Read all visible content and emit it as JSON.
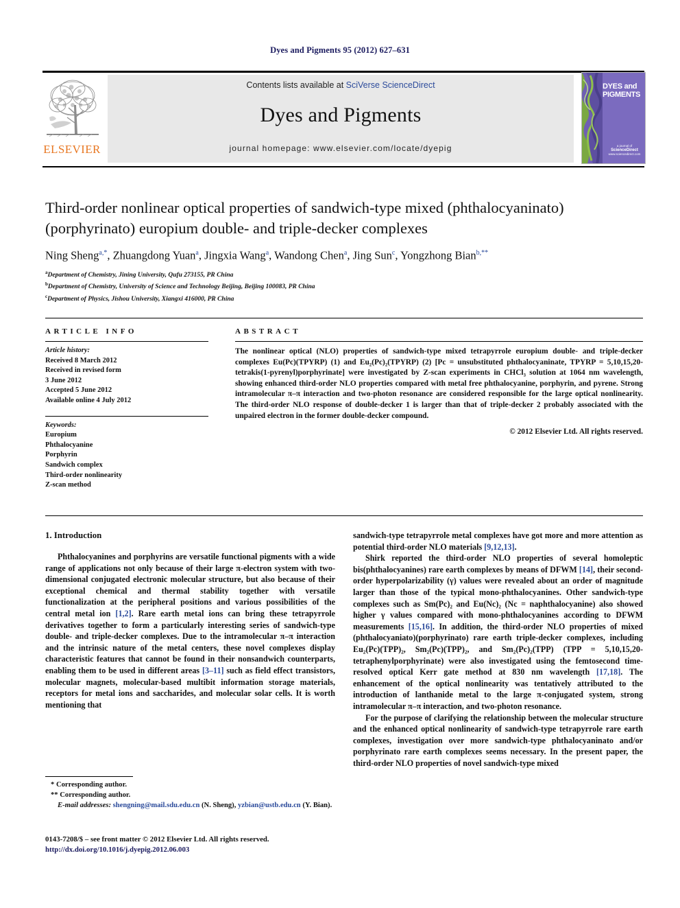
{
  "running_head": "Dyes and Pigments 95 (2012) 627–631",
  "masthead": {
    "contents_prefix": "Contents lists available at ",
    "sciencedirect": "SciVerse ScienceDirect",
    "journal_name": "Dyes and Pigments",
    "homepage": "journal homepage: www.elsevier.com/locate/dyepig",
    "publisher_logo_text": "ELSEVIER",
    "cover_title": "DYES and PIGMENTS",
    "cover_footer_small": "a journal of",
    "cover_footer_brand": "ScienceDirect",
    "cover_footer_url": "www.sciencedirect.com",
    "accent_orange": "#E87722",
    "link_blue": "#2c4b9b",
    "cover_purple": "#7b6bbf"
  },
  "article": {
    "title": "Third-order nonlinear optical properties of sandwich-type mixed (phthalocyaninato)(porphyrinato) europium double- and triple-decker complexes",
    "authors": [
      {
        "name": "Ning Sheng",
        "sup": "a,*"
      },
      {
        "name": "Zhuangdong Yuan",
        "sup": "a"
      },
      {
        "name": "Jingxia Wang",
        "sup": "a"
      },
      {
        "name": "Wandong Chen",
        "sup": "a"
      },
      {
        "name": "Jing Sun",
        "sup": "c"
      },
      {
        "name": "Yongzhong Bian",
        "sup": "b,**"
      }
    ],
    "affiliations": [
      {
        "mark": "a",
        "text": "Department of Chemistry, Jining University, Qufu 273155, PR China"
      },
      {
        "mark": "b",
        "text": "Department of Chemistry, University of Science and Technology Beijing, Beijing 100083, PR China"
      },
      {
        "mark": "c",
        "text": "Department of Physics, Jishou University, Xiangxi 416000, PR China"
      }
    ]
  },
  "article_info": {
    "heading": "ARTICLE INFO",
    "history_label": "Article history:",
    "history": [
      "Received 8 March 2012",
      "Received in revised form",
      "3 June 2012",
      "Accepted 5 June 2012",
      "Available online 4 July 2012"
    ],
    "keywords_label": "Keywords:",
    "keywords": [
      "Europium",
      "Phthalocyanine",
      "Porphyrin",
      "Sandwich complex",
      "Third-order nonlinearity",
      "Z-scan method"
    ]
  },
  "abstract": {
    "heading": "ABSTRACT",
    "text": "The nonlinear optical (NLO) properties of sandwich-type mixed tetrapyrrole europium double- and triple-decker complexes Eu(Pc)(TPYRP) (1) and Eu₂(Pc)₂(TPYRP) (2) [Pc = unsubstituted phthalocyaninate, TPYRP = 5,10,15,20-tetrakis(1-pyrenyl)porphyrinate] were investigated by Z-scan experiments in CHCl₃ solution at 1064 nm wavelength, showing enhanced third-order NLO properties compared with metal free phthalocyanine, porphyrin, and pyrene. Strong intramolecular π–π interaction and two-photon resonance are considered responsible for the large optical nonlinearity. The third-order NLO response of double-decker 1 is larger than that of triple-decker 2 probably associated with the unpaired electron in the former double-decker compound.",
    "copyright": "© 2012 Elsevier Ltd. All rights reserved."
  },
  "body": {
    "section_heading": "1. Introduction",
    "left_paragraph": "Phthalocyanines and porphyrins are versatile functional pigments with a wide range of applications not only because of their large π-electron system with two-dimensional conjugated electronic molecular structure, but also because of their exceptional chemical and thermal stability together with versatile functionalization at the peripheral positions and various possibilities of the central metal ion [1,2]. Rare earth metal ions can bring these tetrapyrrole derivatives together to form a particularly interesting series of sandwich-type double- and triple-decker complexes. Due to the intramolecular π–π interaction and the intrinsic nature of the metal centers, these novel complexes display characteristic features that cannot be found in their nonsandwich counterparts, enabling them to be used in different areas [3–11] such as field effect transistors, molecular magnets, molecular-based multibit information storage materials, receptors for metal ions and saccharides, and molecular solar cells. It is worth mentioning that",
    "right_paragraph_continued": "sandwich-type tetrapyrrole metal complexes have got more and more attention as potential third-order NLO materials [9,12,13].",
    "right_paragraph_2": "Shirk reported the third-order NLO properties of several homoleptic bis(phthalocyanines) rare earth complexes by means of DFWM [14], their second-order hyperpolarizability (γ) values were revealed about an order of magnitude larger than those of the typical mono-phthalocyanines. Other sandwich-type complexes such as Sm(Pc)₂ and Eu(Nc)₂ (Nc = naphthalocyanine) also showed higher γ values compared with mono-phthalocyanines according to DFWM measurements [15,16]. In addition, the third-order NLO properties of mixed (phthalocyaniato)(porphyrinato) rare earth triple-decker complexes, including Eu₂(Pc)(TPP)₂, Sm₂(Pc)(TPP)₂, and Sm₂(Pc)₂(TPP) (TPP = 5,10,15,20- tetraphenylporphyrinate) were also investigated using the femtosecond time-resolved optical Kerr gate method at 830 nm wavelength [17,18]. The enhancement of the optical nonlinearity was tentatively attributed to the introduction of lanthanide metal to the large π-conjugated system, strong intramolecular π–π interaction, and two-photon resonance.",
    "right_paragraph_3": "For the purpose of clarifying the relationship between the molecular structure and the enhanced optical nonlinearity of sandwich-type tetrapyrrole rare earth complexes, investigation over more sandwich-type phthalocyaninato and/or porphyrinato rare earth complexes seems necessary. In the present paper, the third-order NLO properties of novel sandwich-type mixed"
  },
  "footnotes": {
    "corresponding_1": "* Corresponding author.",
    "corresponding_2": "** Corresponding author.",
    "email_label": "E-mail addresses:",
    "email_1": "shengning@mail.sdu.edu.cn",
    "email_1_attr": "(N. Sheng),",
    "email_2": "yzbian@ustb.edu.cn",
    "email_2_attr": "(Y. Bian)."
  },
  "footer": {
    "issn_line": "0143-7208/$ – see front matter © 2012 Elsevier Ltd. All rights reserved.",
    "doi": "http://dx.doi.org/10.1016/j.dyepig.2012.06.003"
  }
}
